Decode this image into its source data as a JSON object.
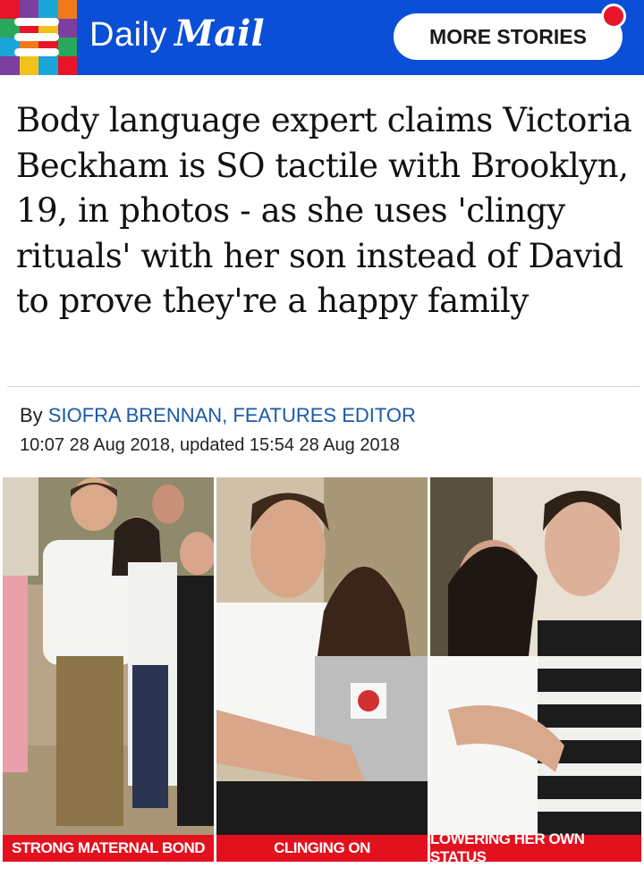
{
  "header": {
    "brand_daily": "Daily",
    "brand_mail": "Mail",
    "more_stories_label": "MORE STORIES",
    "accent_color": "#0a4fd6",
    "notification_color": "#e8152a",
    "menu_icon": "hamburger-menu-icon"
  },
  "article": {
    "headline": "Body language expert claims Victoria Beckham is SO tactile with Brooklyn, 19, in photos - as she uses 'clingy rituals' with her son instead of David to prove they're a happy family",
    "byline_prefix": "By ",
    "author": "SIOFRA BRENNAN, FEATURES EDITOR",
    "dateline": "10:07 28 Aug 2018, updated 15:54 28 Aug 2018"
  },
  "photos": [
    {
      "caption": "STRONG MATERNAL BOND"
    },
    {
      "caption": "CLINGING ON"
    },
    {
      "caption": "LOWERING HER OWN STATUS"
    }
  ],
  "colors": {
    "caption_bar": "#e3101e",
    "author_link": "#1a5aa8"
  }
}
